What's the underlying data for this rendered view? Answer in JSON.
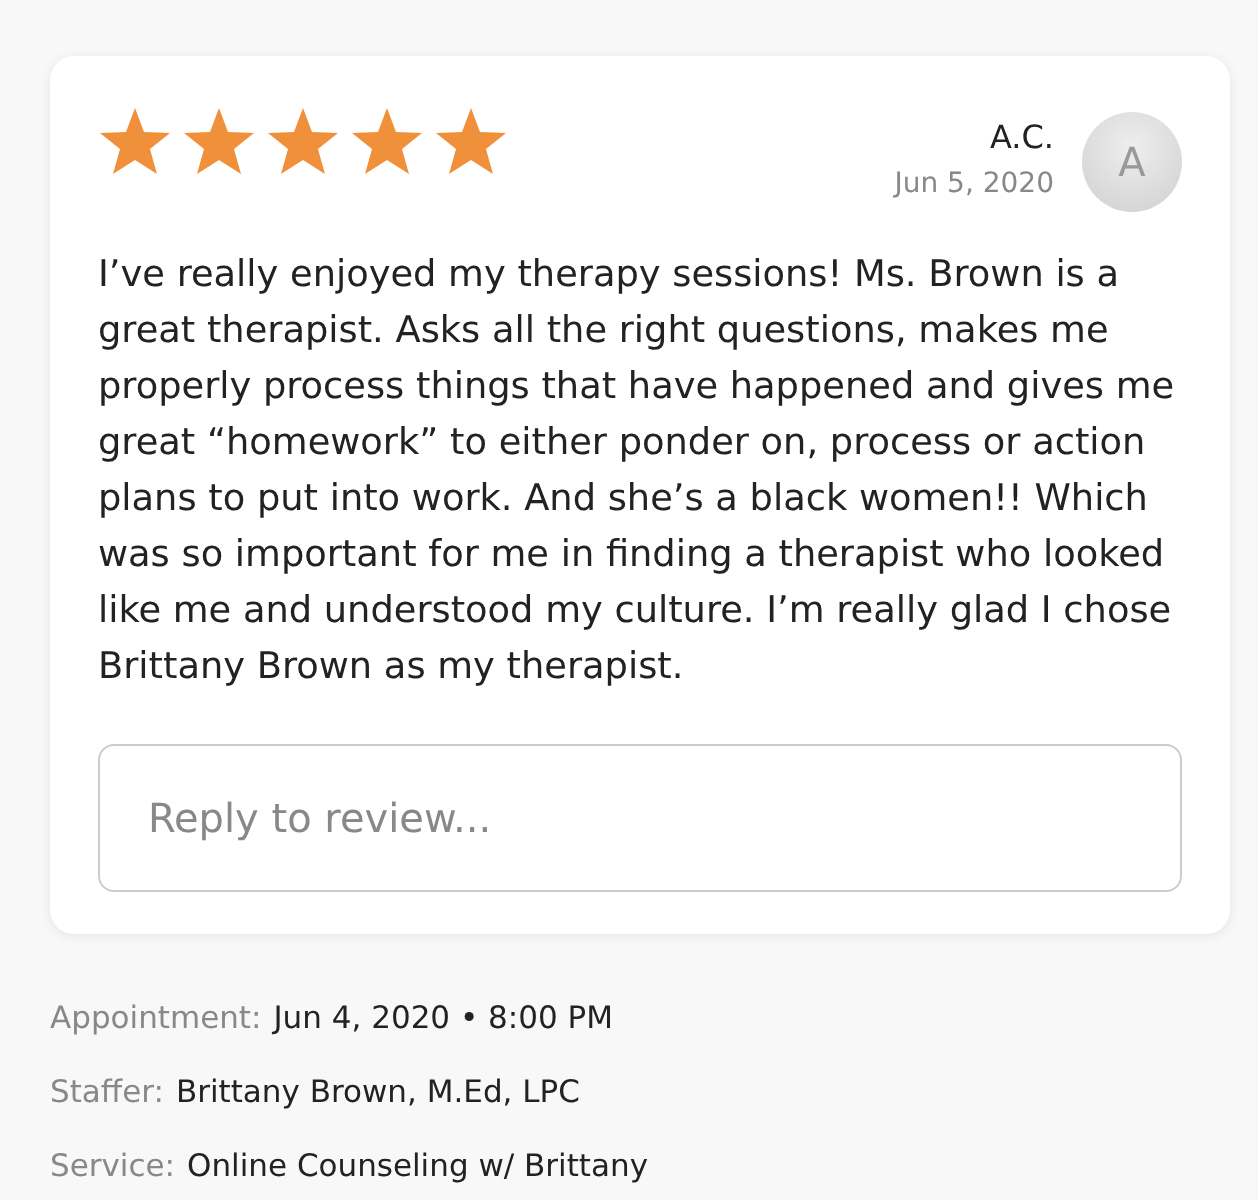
{
  "review": {
    "stars": 5,
    "author": "A.C.",
    "date": "Jun 5, 2020",
    "avatar_letter": "A",
    "text": "I’ve really enjoyed my therapy sessions! Ms. Brown is a great therapist. Asks all the right questions, makes me properly process things that have happened and gives me great “homework” to either ponder on, process or action plans to put into work. And she’s a black women!! Which was so important for me in finding a therapist who looked like me and understood my culture. I’m really glad I chose Brittany Brown as my therapist.",
    "reply": {
      "placeholder": "Reply to review..."
    }
  },
  "details": [
    {
      "label": "Appointment:",
      "value": "Jun 4, 2020 • 8:00 PM"
    },
    {
      "label": "Staffer:",
      "value": "Brittany Brown, M.Ed, LPC"
    },
    {
      "label": "Service:",
      "value": "Online Counseling w/ Brittany"
    }
  ]
}
